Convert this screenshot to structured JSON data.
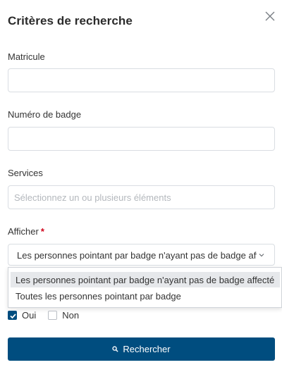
{
  "panel": {
    "title": "Critères de recherche",
    "close_icon": "close-icon"
  },
  "fields": {
    "matricule": {
      "label": "Matricule",
      "value": ""
    },
    "badge": {
      "label": "Numéro de badge",
      "value": ""
    },
    "services": {
      "label": "Services",
      "placeholder": "Sélectionnez un ou plusieurs éléments"
    },
    "afficher": {
      "label": "Afficher",
      "required_marker": "*",
      "selected": "Les personnes pointant par badge n'ayant pas de badge affecté",
      "options": [
        "Les personnes pointant par badge n'ayant pas de badge affecté",
        "Toutes les personnes pointant par badge"
      ]
    }
  },
  "checkboxes": {
    "oui": {
      "label": "Oui",
      "checked": true
    },
    "non": {
      "label": "Non",
      "checked": false
    }
  },
  "actions": {
    "search_label": "Rechercher",
    "search_icon": "search-icon"
  },
  "colors": {
    "primary": "#004d7f",
    "required": "#d0021b",
    "border": "#d9dde2",
    "highlight": "#e6e8eb"
  }
}
